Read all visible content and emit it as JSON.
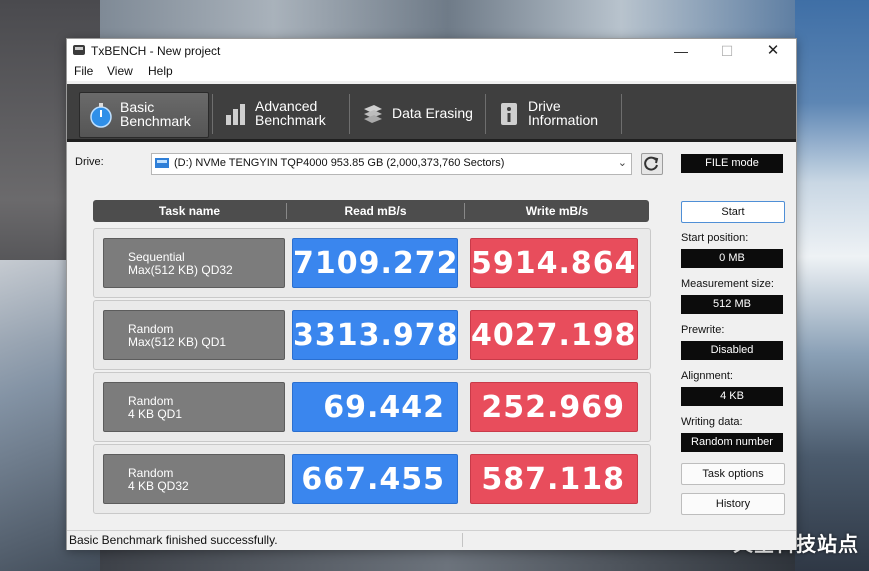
{
  "window": {
    "title": "TxBENCH - New project"
  },
  "menu": [
    "File",
    "View",
    "Help"
  ],
  "toolbar": [
    {
      "line1": "Basic",
      "line2": "Benchmark",
      "icon": "stopwatch-icon",
      "active": true
    },
    {
      "line1": "Advanced",
      "line2": "Benchmark",
      "icon": "bar-chart-icon",
      "active": false
    },
    {
      "line1": "Data Erasing",
      "line2": "",
      "icon": "erase-icon",
      "active": false
    },
    {
      "line1": "Drive",
      "line2": "Information",
      "icon": "drive-info-icon",
      "active": false
    }
  ],
  "drive": {
    "label": "Drive:",
    "selected": "(D:) NVMe TENGYIN TQP4000  953.85 GB (2,000,373,760 Sectors)",
    "mode": "FILE mode"
  },
  "results": {
    "headers": [
      "Task name",
      "Read mB/s",
      "Write mB/s"
    ],
    "rows": [
      {
        "task1": "Sequential",
        "task2": "Max(512 KB) QD32",
        "read": "7109.272",
        "write": "5914.864"
      },
      {
        "task1": "Random",
        "task2": "Max(512 KB) QD1",
        "read": "3313.978",
        "write": "4027.198"
      },
      {
        "task1": "Random",
        "task2": "4 KB QD1",
        "read": "69.442",
        "write": "252.969"
      },
      {
        "task1": "Random",
        "task2": "4 KB QD32",
        "read": "667.455",
        "write": "587.118"
      }
    ]
  },
  "side": {
    "start": "Start",
    "start_position_label": "Start position:",
    "start_position": "0 MB",
    "measurement_size_label": "Measurement size:",
    "measurement_size": "512 MB",
    "prewrite_label": "Prewrite:",
    "prewrite": "Disabled",
    "alignment_label": "Alignment:",
    "alignment": "4 KB",
    "writing_data_label": "Writing data:",
    "writing_data": "Random number",
    "task_options": "Task options",
    "history": "History"
  },
  "status": {
    "text": "Basic Benchmark finished successfully."
  },
  "watermark": "火星科技站点",
  "colors": {
    "read": "#3a86ee",
    "write": "#e84d5c",
    "toolbar": "#3f3f3f"
  }
}
